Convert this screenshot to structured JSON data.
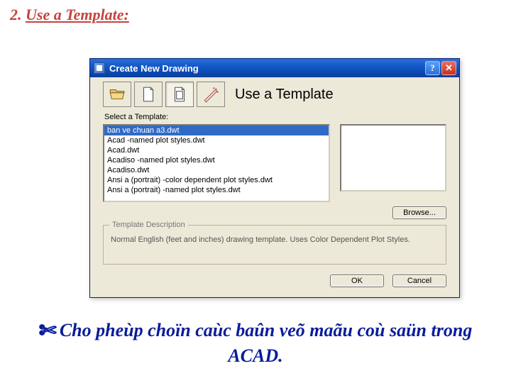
{
  "slide": {
    "heading_num": "2.",
    "heading_text": "Use a Template:",
    "footer_icon": "✄",
    "footer_line1": "Cho pheùp choïn caùc baûn veõ maãu coù saün trong",
    "footer_line2": "ACAD."
  },
  "dialog": {
    "title": "Create New Drawing",
    "help_label": "?",
    "close_label": "✕",
    "mode_title": "Use a Template",
    "select_label": "Select a Template:",
    "templates": [
      "ban ve chuan a3.dwt",
      "Acad -named plot styles.dwt",
      "Acad.dwt",
      "Acadiso -named plot styles.dwt",
      "Acadiso.dwt",
      "Ansi a (portrait) -color dependent plot styles.dwt",
      "Ansi a (portrait) -named plot styles.dwt"
    ],
    "selected_index": 0,
    "browse_label": "Browse...",
    "desc_legend": "Template Description",
    "desc_text": "Normal English (feet and inches) drawing template. Uses Color Dependent Plot Styles.",
    "ok_label": "OK",
    "cancel_label": "Cancel"
  }
}
